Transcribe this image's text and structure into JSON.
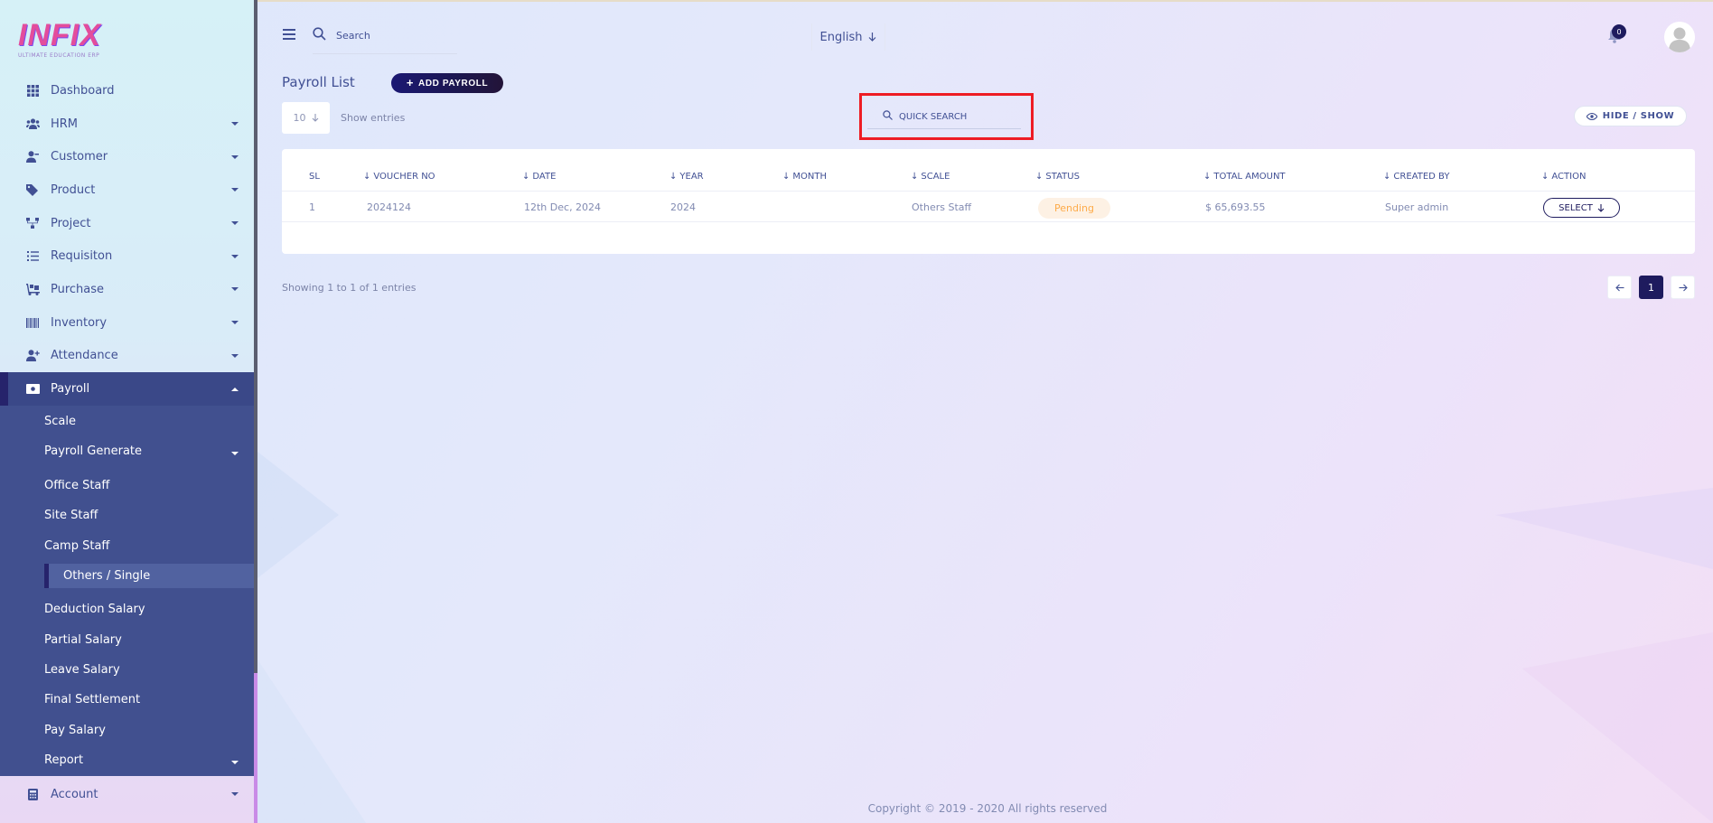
{
  "sidebar": {
    "logo": {
      "text": "INFIX",
      "tagline": "Ultimate Education ERP"
    },
    "items": [
      {
        "label": "Dashboard",
        "icon": "grid-icon",
        "caret": false
      },
      {
        "label": "HRM",
        "icon": "users-icon",
        "caret": true
      },
      {
        "label": "Customer",
        "icon": "user-icon",
        "caret": true
      },
      {
        "label": "Product",
        "icon": "tags-icon",
        "caret": true
      },
      {
        "label": "Project",
        "icon": "sitemap-icon",
        "caret": true
      },
      {
        "label": "Requisiton",
        "icon": "list-icon",
        "caret": true
      },
      {
        "label": "Purchase",
        "icon": "dolly-icon",
        "caret": true
      },
      {
        "label": "Inventory",
        "icon": "barcode-icon",
        "caret": true
      },
      {
        "label": "Attendance",
        "icon": "user-plus-icon",
        "caret": true
      }
    ],
    "payroll": {
      "label": "Payroll",
      "icon": "money-icon",
      "sub": [
        {
          "label": "Scale"
        },
        {
          "label": "Payroll Generate",
          "caret": true
        },
        {
          "label": "Office Staff"
        },
        {
          "label": "Site Staff"
        },
        {
          "label": "Camp Staff"
        },
        {
          "label": "Others / Single",
          "active": true
        },
        {
          "label": "Deduction Salary"
        },
        {
          "label": "Partial Salary"
        },
        {
          "label": "Leave Salary"
        },
        {
          "label": "Final Settlement"
        },
        {
          "label": "Pay Salary"
        },
        {
          "label": "Report",
          "caret": true
        }
      ]
    },
    "account": {
      "label": "Account",
      "icon": "calculator-icon"
    }
  },
  "header": {
    "search_placeholder": "Search",
    "language": "English",
    "notification_count": "0"
  },
  "content": {
    "title": "Payroll List",
    "add_button": "ADD PAYROLL",
    "entries_value": "10",
    "entries_label": "Show entries",
    "quick_search_placeholder": "QUICK SEARCH",
    "hide_show_label": "HIDE / SHOW",
    "columns": [
      "SL",
      "VOUCHER NO",
      "DATE",
      "YEAR",
      "MONTH",
      "SCALE",
      "STATUS",
      "TOTAL AMOUNT",
      "CREATED BY",
      "ACTION"
    ],
    "rows": [
      {
        "sl": "1",
        "voucher_no": "2024124",
        "date": "12th Dec, 2024",
        "year": "2024",
        "month": "",
        "scale": "Others Staff",
        "status": "Pending",
        "total_amount": "$ 65,693.55",
        "created_by": "Super admin",
        "action": "SELECT"
      }
    ],
    "showing_text": "Showing 1 to 1 of 1 entries",
    "pagination": {
      "current": "1"
    }
  },
  "footer": {
    "copyright": "Copyright © 2019 - 2020 All rights reserved"
  },
  "colors": {
    "primary": "#415094",
    "dark_accent": "#1e1b5e",
    "pending": "#fdab4a",
    "highlight": "#ee1c24"
  }
}
